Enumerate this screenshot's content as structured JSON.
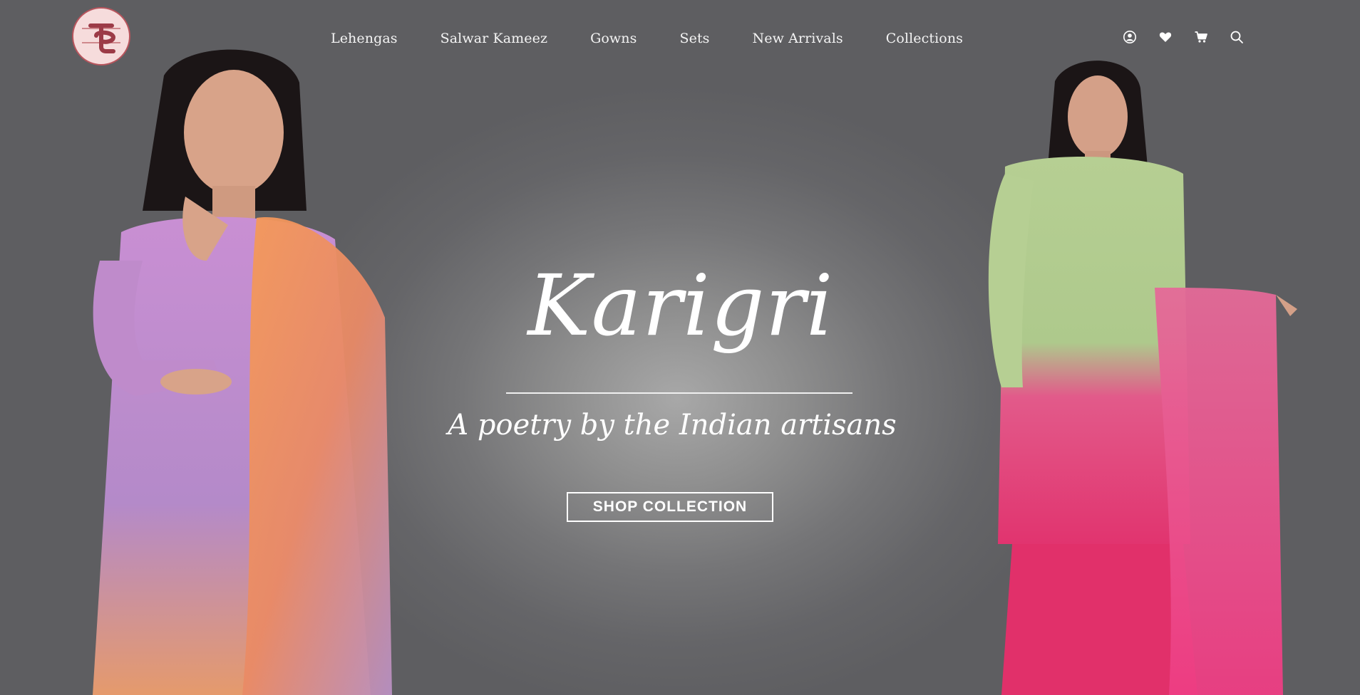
{
  "brand": {
    "logo_icon": "tc-monogram-logo"
  },
  "nav": {
    "items": [
      {
        "label": "Lehengas"
      },
      {
        "label": "Salwar Kameez"
      },
      {
        "label": "Gowns"
      },
      {
        "label": "Sets"
      },
      {
        "label": "New Arrivals"
      },
      {
        "label": "Collections"
      }
    ]
  },
  "header_icons": [
    {
      "name": "account-icon"
    },
    {
      "name": "wishlist-heart-icon"
    },
    {
      "name": "cart-icon"
    },
    {
      "name": "search-icon"
    }
  ],
  "hero": {
    "title": "Karigri",
    "tagline": "A poetry by the Indian artisans",
    "cta_label": "SHOP COLLECTION"
  },
  "colors": {
    "background": "#6b6b6e",
    "text": "#ffffff",
    "logo_bg": "#f6dcdc",
    "logo_accent": "#b8555d"
  }
}
